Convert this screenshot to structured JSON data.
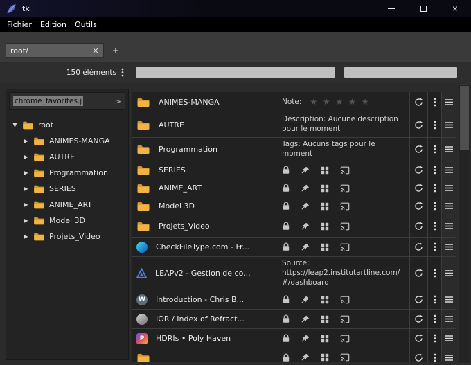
{
  "window": {
    "title": "tk",
    "controls": {
      "close_label": "×"
    }
  },
  "menubar": {
    "items": [
      {
        "label": "Fichier"
      },
      {
        "label": "Edition"
      },
      {
        "label": "Outils"
      }
    ]
  },
  "toolbar": {
    "path_value": "root/",
    "clear_label": "×",
    "add_label": "+"
  },
  "status": {
    "count_label": "150 éléments"
  },
  "sidebar": {
    "file_value": "chrome_favorites.j",
    "expand_label": ">",
    "tree": {
      "glyph_open": "▼",
      "glyph_closed": "▶",
      "root": {
        "label": "root"
      },
      "children": [
        {
          "label": "ANIMES-MANGA"
        },
        {
          "label": "AUTRE"
        },
        {
          "label": "Programmation"
        },
        {
          "label": "SERIES"
        },
        {
          "label": "ANIME_ART"
        },
        {
          "label": "Model 3D"
        },
        {
          "label": "Projets_Video"
        }
      ]
    }
  },
  "icons": {
    "refresh": "sync-circular-arrow",
    "more": "vertical-dots",
    "menu": "hamburger",
    "lock": "padlock",
    "pin": "pushpin",
    "grid": "grid-squares",
    "cast": "cast-screen",
    "folder_color": "#e8a33d",
    "wordpress_letter": "W",
    "polyhaven_letter": "P"
  },
  "colors": {
    "star": "#555555",
    "progress_bar": "#bfbfbf",
    "accent_blue": "#4a7fe0"
  },
  "list": {
    "rows": [
      {
        "name": "ANIMES-MANGA",
        "icon": "folder-icon",
        "note_label": "Note:",
        "stars": "★ ★ ★ ★ ★"
      },
      {
        "name": "AUTRE",
        "icon": "folder-icon",
        "info": "Description: Aucune description pour le moment"
      },
      {
        "name": "Programmation",
        "icon": "folder-icon",
        "info": "Tags: Aucuns tags pour le moment"
      },
      {
        "name": "SERIES",
        "icon": "folder-icon"
      },
      {
        "name": "ANIME_ART",
        "icon": "folder-icon"
      },
      {
        "name": "Model 3D",
        "icon": "folder-icon"
      },
      {
        "name": "Projets_Video",
        "icon": "folder-icon"
      },
      {
        "name": "CheckFileType.com - Fr...",
        "icon": "checkfiletype-favicon"
      },
      {
        "name": "LEAPv2 - Gestion de co...",
        "icon": "leapv2-favicon",
        "info": "Source: https://leap2.institutartline.com/#/dashboard"
      },
      {
        "name": "Introduction - Chris B...",
        "icon": "wordpress-favicon"
      },
      {
        "name": "IOR / Index of Refract...",
        "icon": "ior-favicon"
      },
      {
        "name": "HDRIs • Poly Haven",
        "icon": "polyhaven-favicon"
      },
      {
        "name": "",
        "icon": "folder-icon"
      }
    ]
  }
}
